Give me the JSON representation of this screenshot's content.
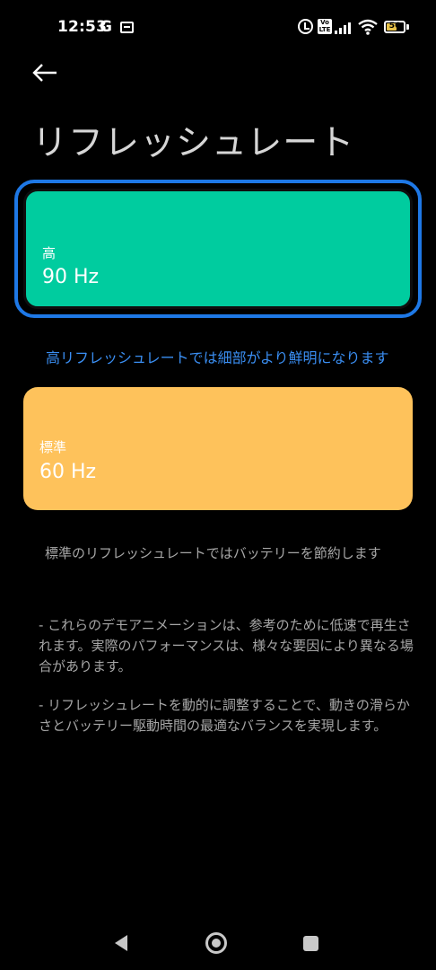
{
  "status_bar": {
    "time": "12:53",
    "g_label": "G",
    "volte_label": "Vo LTE",
    "battery_level": "56"
  },
  "header": {
    "title": "リフレッシュレート"
  },
  "options": [
    {
      "label": "高",
      "value": "90 Hz",
      "color": "#00cc9f",
      "selected": true
    },
    {
      "label": "標準",
      "value": "60 Hz",
      "color": "#fec25b",
      "selected": false
    }
  ],
  "notes": {
    "high": "高リフレッシュレートでは細部がより鮮明になります",
    "standard": "標準のリフレッシュレートではバッテリーを節約します",
    "description_1": "- これらのデモアニメーションは、参考のために低速で再生されます。実際のパフォーマンスは、様々な要因により異なる場合があります。",
    "description_2": "- リフレッシュレートを動的に調整することで、動きの滑らかさとバッテリー駆動時間の最適なバランスを実現します。"
  },
  "colors": {
    "accent": "#1e78e6",
    "note_link": "#3a8ef2"
  }
}
